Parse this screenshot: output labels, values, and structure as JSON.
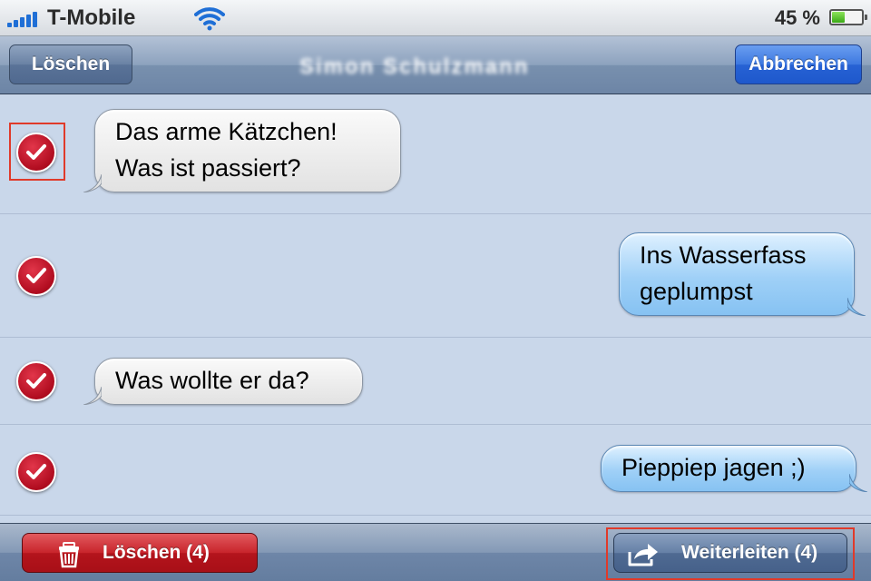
{
  "status_bar": {
    "carrier": "T-Mobile",
    "battery_percent": "45 %",
    "battery_level": 0.45,
    "icons": [
      "signal-bars-icon",
      "wifi-icon",
      "battery-icon"
    ]
  },
  "nav": {
    "left_button": "Löschen",
    "title": "Simon Schulzmann",
    "right_button": "Abbrechen"
  },
  "messages": [
    {
      "direction": "incoming",
      "lines": [
        "Das arme Kätzchen!",
        "Was ist passiert?"
      ],
      "selected": true,
      "highlighted": true
    },
    {
      "direction": "outgoing",
      "lines": [
        "Ins Wasserfass",
        "geplumpst"
      ],
      "selected": true,
      "highlighted": false
    },
    {
      "direction": "incoming",
      "lines": [
        "Was wollte er da?"
      ],
      "selected": true,
      "highlighted": false
    },
    {
      "direction": "outgoing",
      "lines": [
        "Pieppiep jagen ;)"
      ],
      "selected": true,
      "highlighted": false
    }
  ],
  "toolbar": {
    "delete_label": "Löschen (4)",
    "forward_label": "Weiterleiten (4)",
    "delete_icon": "trash-icon",
    "forward_icon": "share-arrow-icon"
  },
  "colors": {
    "incoming_bubble": "#ededed",
    "outgoing_bubble": "#9fd0f7",
    "checkmark_red": "#c0152a",
    "highlight_border": "#e03a2a",
    "accent_blue": "#2762d4"
  }
}
